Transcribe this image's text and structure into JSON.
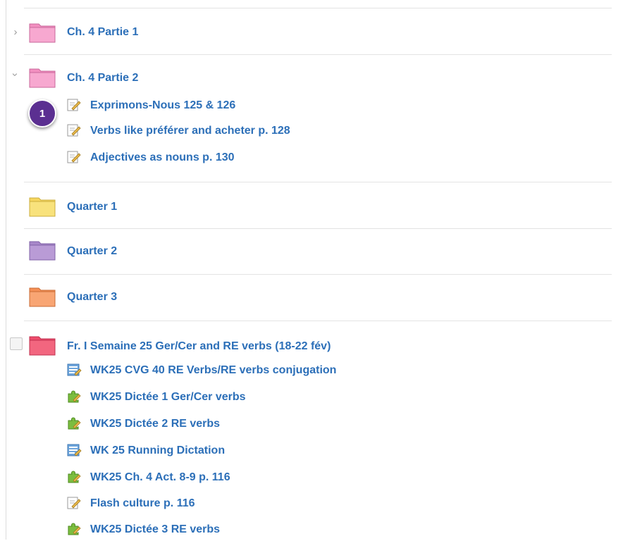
{
  "folders": [
    {
      "label": "Ch. 4 Partie 1",
      "color": "#f28fc0",
      "state": "collapsed"
    },
    {
      "label": "Ch. 4 Partie 2",
      "color": "#f28fc0",
      "state": "expanded",
      "items": [
        {
          "label": "Exprimons-Nous 125 & 126",
          "icon": "assignment-pencil-icon"
        },
        {
          "label": "Verbs like préférer and acheter p. 128",
          "icon": "assignment-pencil-icon"
        },
        {
          "label": "Adjectives as nouns p. 130",
          "icon": "assignment-pencil-icon"
        }
      ]
    },
    {
      "label": "Quarter 1",
      "color": "#f6d65e"
    },
    {
      "label": "Quarter 2",
      "color": "#a887c9"
    },
    {
      "label": "Quarter 3",
      "color": "#f59055"
    },
    {
      "label": "Fr. I Semaine 25 Ger/Cer and RE verbs (18-22 fév)",
      "color": "#ee4d6c",
      "state": "expanded",
      "items": [
        {
          "label": "WK25 CVG 40 RE Verbs/RE verbs conjugation",
          "icon": "assessment-icon"
        },
        {
          "label": "WK25 Dictée 1 Ger/Cer verbs",
          "icon": "puzzle-icon"
        },
        {
          "label": "WK25 Dictée 2 RE verbs",
          "icon": "puzzle-icon"
        },
        {
          "label": "WK 25 Running Dictation",
          "icon": "assessment-icon"
        },
        {
          "label": "WK25 Ch. 4 Act. 8-9 p. 116",
          "icon": "puzzle-icon"
        },
        {
          "label": "Flash culture p. 116",
          "icon": "assignment-pencil-icon"
        },
        {
          "label": "WK25 Dictée 3 RE verbs",
          "icon": "puzzle-icon"
        }
      ]
    }
  ],
  "badge": "1",
  "icons": {
    "chevron_right": "›",
    "chevron_down": "⌄"
  }
}
